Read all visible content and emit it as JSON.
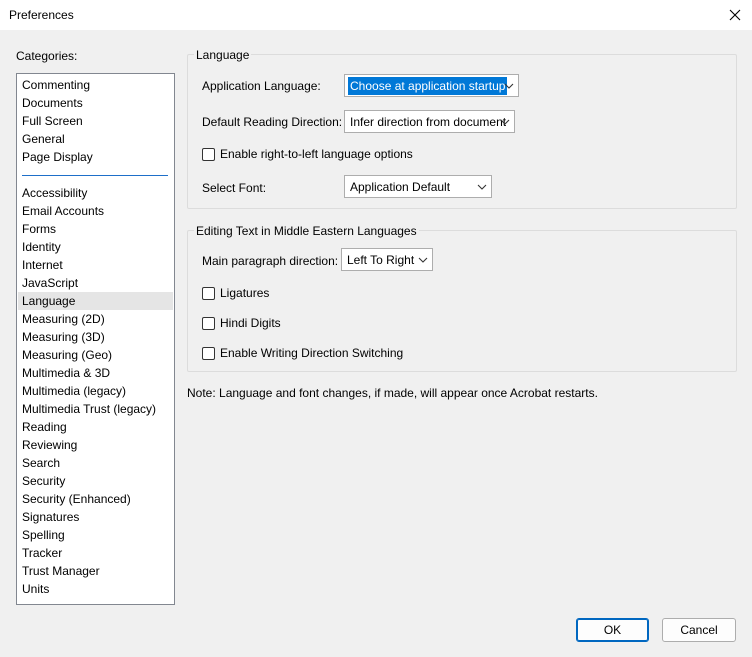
{
  "window": {
    "title": "Preferences"
  },
  "categories": {
    "label": "Categories:",
    "top_items": [
      "Commenting",
      "Documents",
      "Full Screen",
      "General",
      "Page Display"
    ],
    "items": [
      "Accessibility",
      "Email Accounts",
      "Forms",
      "Identity",
      "Internet",
      "JavaScript",
      "Language",
      "Measuring (2D)",
      "Measuring (3D)",
      "Measuring (Geo)",
      "Multimedia & 3D",
      "Multimedia (legacy)",
      "Multimedia Trust (legacy)",
      "Reading",
      "Reviewing",
      "Search",
      "Security",
      "Security (Enhanced)",
      "Signatures",
      "Spelling",
      "Tracker",
      "Trust Manager",
      "Units"
    ],
    "selected": "Language"
  },
  "language": {
    "group_title": "Language",
    "app_language_label": "Application Language:",
    "app_language_value": "Choose at application startup",
    "reading_direction_label": "Default Reading Direction:",
    "reading_direction_value": "Infer direction from document",
    "rtl_checkbox_label": "Enable right-to-left language options",
    "select_font_label": "Select Font:",
    "select_font_value": "Application Default"
  },
  "middle_eastern": {
    "group_title": "Editing Text in Middle Eastern Languages",
    "paragraph_direction_label": "Main paragraph direction:",
    "paragraph_direction_value": "Left To Right",
    "ligatures_label": "Ligatures",
    "hindi_digits_label": "Hindi Digits",
    "writing_direction_label": "Enable Writing Direction Switching"
  },
  "note": "Note: Language and font changes, if made, will appear once Acrobat restarts.",
  "buttons": {
    "ok": "OK",
    "cancel": "Cancel"
  },
  "colors": {
    "selection": "#0078d7",
    "accent_border": "#0067c0",
    "separator": "#1e6fc9"
  }
}
